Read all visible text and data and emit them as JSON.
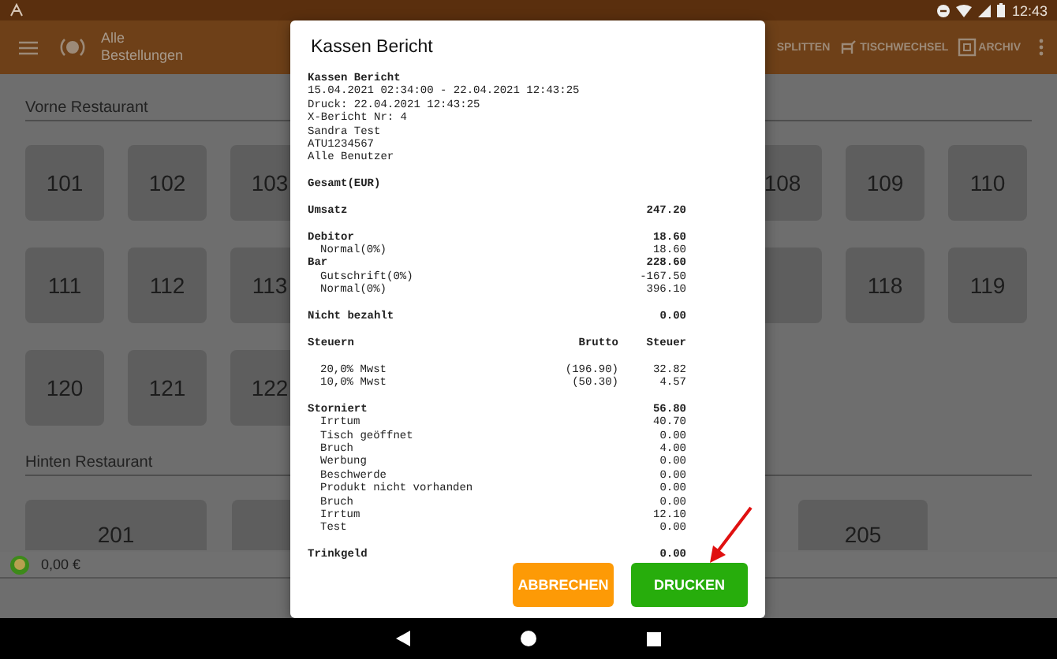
{
  "status_bar": {
    "time": "12:43"
  },
  "app_bar": {
    "title": "Alle Bestellungen",
    "actions": [
      {
        "label": "SPLITTEN",
        "kind": "split"
      },
      {
        "label": "TISCHWECHSEL",
        "kind": "swap"
      },
      {
        "label": "ARCHIV",
        "kind": "archive"
      }
    ]
  },
  "sections": [
    {
      "title": "Vorne Restaurant",
      "kind": "small",
      "rows": [
        {
          "left": [
            {
              "kind": "tile",
              "label": "101"
            },
            {
              "kind": "tile",
              "label": "102"
            },
            {
              "kind": "tile",
              "label": "103"
            }
          ],
          "right": [
            {
              "kind": "tile",
              "label": "108"
            },
            {
              "kind": "tile",
              "label": "109"
            },
            {
              "kind": "tile",
              "label": "110"
            }
          ]
        },
        {
          "left": [
            {
              "kind": "tile",
              "label": "111"
            },
            {
              "kind": "tile",
              "label": "112"
            },
            {
              "kind": "tile",
              "label": "113"
            }
          ],
          "right": [
            {
              "kind": "tile"
            },
            {
              "kind": "tile",
              "label": "118"
            },
            {
              "kind": "tile",
              "label": "119"
            }
          ]
        },
        {
          "left": [
            {
              "kind": "tile",
              "label": "120"
            },
            {
              "kind": "tile",
              "label": "121"
            },
            {
              "kind": "tile",
              "label": "122"
            }
          ]
        }
      ]
    },
    {
      "title": "Hinten Restaurant",
      "kind": "wide",
      "rows": [
        {
          "left": [
            {
              "kind": "tile",
              "label": "201"
            },
            {
              "kind": "tile"
            }
          ],
          "right": [
            {
              "kind": "tile",
              "label": "205"
            }
          ]
        }
      ]
    }
  ],
  "footer": {
    "amount": "0,00 €"
  },
  "dialog": {
    "title": "Kassen Bericht",
    "report": [
      {
        "kind": "bold",
        "label": "Kassen Bericht"
      },
      {
        "kind": "plain",
        "label": "15.04.2021 02:34:00 - 22.04.2021 12:43:25"
      },
      {
        "kind": "plain",
        "label": "Druck: 22.04.2021 12:43:25"
      },
      {
        "kind": "plain",
        "label": "X-Bericht Nr: 4"
      },
      {
        "kind": "plain",
        "label": "Sandra Test"
      },
      {
        "kind": "plain",
        "label": "ATU1234567"
      },
      {
        "kind": "plain",
        "label": "Alle Benutzer"
      },
      {
        "kind": "gap"
      },
      {
        "kind": "bold",
        "label": "Gesamt(EUR)"
      },
      {
        "kind": "gap"
      },
      {
        "kind": "bold",
        "label": "Umsatz",
        "value": "247.20"
      },
      {
        "kind": "gap"
      },
      {
        "kind": "bold",
        "label": "Debitor",
        "value": "18.60"
      },
      {
        "kind": "indented",
        "label": "Normal(0%)",
        "value": "18.60"
      },
      {
        "kind": "bold",
        "label": "Bar",
        "value": "228.60"
      },
      {
        "kind": "indented",
        "label": "Gutschrift(0%)",
        "value": "-167.50"
      },
      {
        "kind": "indented",
        "label": "Normal(0%)",
        "value": "396.10"
      },
      {
        "kind": "gap"
      },
      {
        "kind": "bold",
        "label": "Nicht bezahlt",
        "value": "0.00"
      },
      {
        "kind": "gap"
      },
      {
        "kind": "bold",
        "label": "Steuern",
        "brutto": "Brutto",
        "value": "Steuer"
      },
      {
        "kind": "gap"
      },
      {
        "kind": "indented",
        "label": "20,0% Mwst",
        "brutto": "(196.90)",
        "value": "32.82"
      },
      {
        "kind": "indented",
        "label": "10,0% Mwst",
        "brutto": "(50.30)",
        "value": "4.57"
      },
      {
        "kind": "gap"
      },
      {
        "kind": "bold",
        "label": "Storniert",
        "value": "56.80"
      },
      {
        "kind": "indented",
        "label": "Irrtum",
        "value": "40.70"
      },
      {
        "kind": "indented",
        "label": "Tisch geöffnet",
        "value": "0.00"
      },
      {
        "kind": "indented",
        "label": "Bruch",
        "value": "4.00"
      },
      {
        "kind": "indented",
        "label": "Werbung",
        "value": "0.00"
      },
      {
        "kind": "indented",
        "label": "Beschwerde",
        "value": "0.00"
      },
      {
        "kind": "indented",
        "label": "Produkt nicht vorhanden",
        "value": "0.00"
      },
      {
        "kind": "indented",
        "label": "Bruch",
        "value": "0.00"
      },
      {
        "kind": "indented",
        "label": "Irrtum",
        "value": "12.10"
      },
      {
        "kind": "indented",
        "label": "Test",
        "value": "0.00"
      },
      {
        "kind": "gap"
      },
      {
        "kind": "bold",
        "label": "Trinkgeld",
        "value": "0.00"
      }
    ],
    "buttons": [
      {
        "label": "ABBRECHEN",
        "kind": "cancel"
      },
      {
        "label": "DRUCKEN",
        "kind": "confirm"
      }
    ]
  }
}
